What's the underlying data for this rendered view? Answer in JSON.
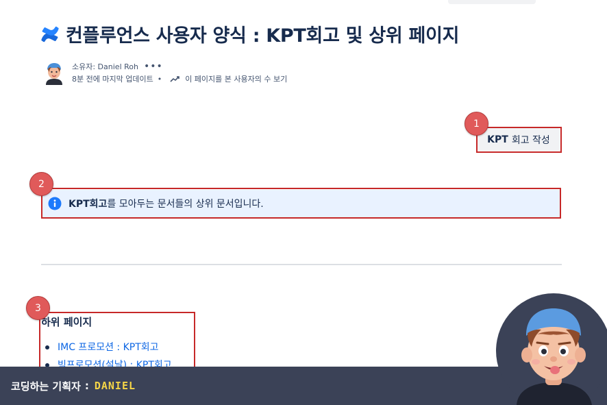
{
  "page": {
    "title": "컨플루언스 사용자 양식 : KPT회고 및 상위 페이지",
    "owner_label": "소유자: Daniel Roh",
    "more_label": "•••",
    "updated_label": "8분 전에 마지막 업데이트",
    "separator": "•",
    "viewers_label": "이 페이지를 본 사용자의 수 보기"
  },
  "annotations": [
    "1",
    "2",
    "3"
  ],
  "kpt_button": {
    "bold": "KPT",
    "rest": "회고 작성"
  },
  "info_panel": {
    "bold": "KPT회고",
    "rest": "를 모아두는 문서들의 상위 문서입니다."
  },
  "child_pages": {
    "heading": "하위 페이지",
    "items": [
      "IMC 프로모션 : KPT회고",
      "빅프로모션(설날) : KPT회고"
    ]
  },
  "footer": {
    "label": "코딩하는 기획자",
    "separator": ":",
    "name": "DANIEL"
  },
  "colors": {
    "link": "#0c66e4",
    "info_bg": "#e9f2ff",
    "badge": "#e05a5a",
    "annotation_border": "#c62828",
    "footer_bg": "#3b4257",
    "footer_name": "#f5d547"
  },
  "icons": [
    "confluence-logo",
    "info-icon",
    "chart-icon",
    "avatar"
  ]
}
